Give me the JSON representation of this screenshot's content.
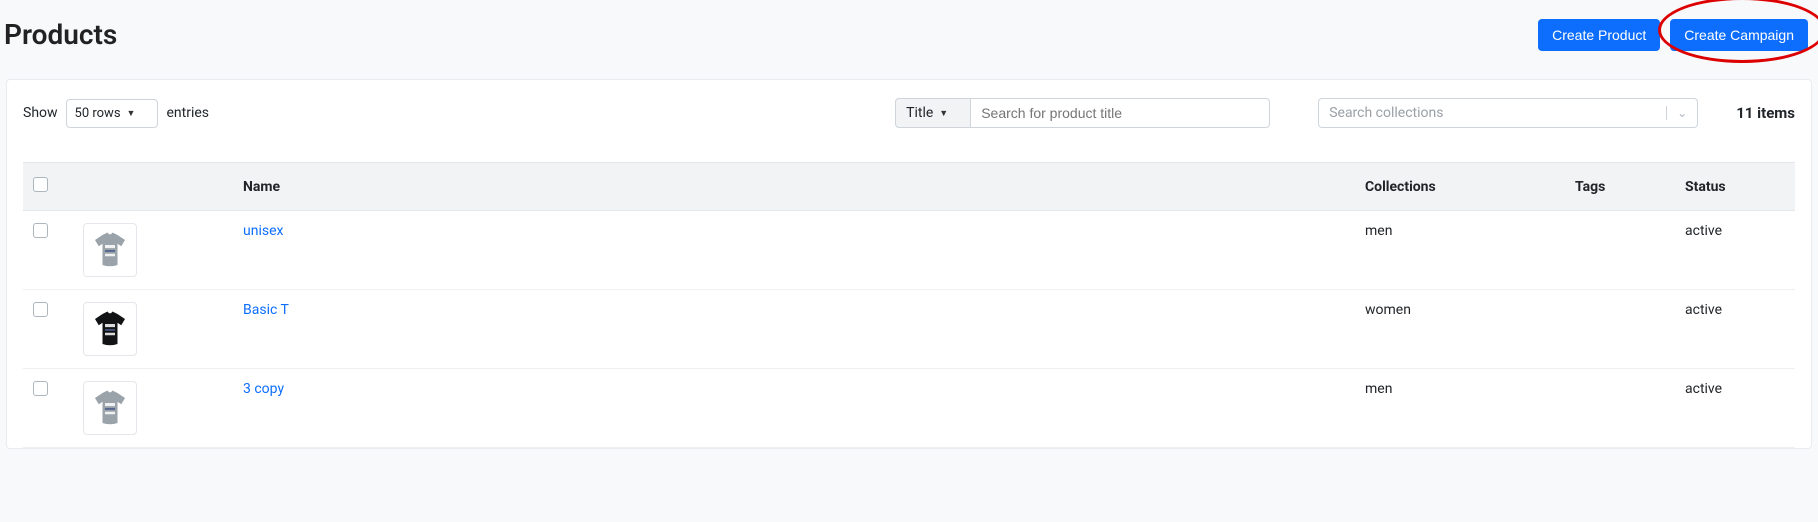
{
  "header": {
    "title": "Products",
    "create_product_label": "Create Product",
    "create_campaign_label": "Create Campaign"
  },
  "toolbar": {
    "show_label": "Show",
    "rows_select_value": "50 rows",
    "entries_label": "entries",
    "search_field_value": "Title",
    "search_placeholder": "Search for product title",
    "collections_placeholder": "Search collections",
    "items_count_label": "11 items"
  },
  "table": {
    "headers": {
      "name": "Name",
      "collections": "Collections",
      "tags": "Tags",
      "status": "Status"
    },
    "rows": [
      {
        "name": "unisex",
        "collections": "men",
        "tags": "",
        "status": "active",
        "thumb_color": "#9aa2aa"
      },
      {
        "name": "Basic T",
        "collections": "women",
        "tags": "",
        "status": "active",
        "thumb_color": "#111315"
      },
      {
        "name": "3 copy",
        "collections": "men",
        "tags": "",
        "status": "active",
        "thumb_color": "#9aa2aa"
      }
    ]
  }
}
